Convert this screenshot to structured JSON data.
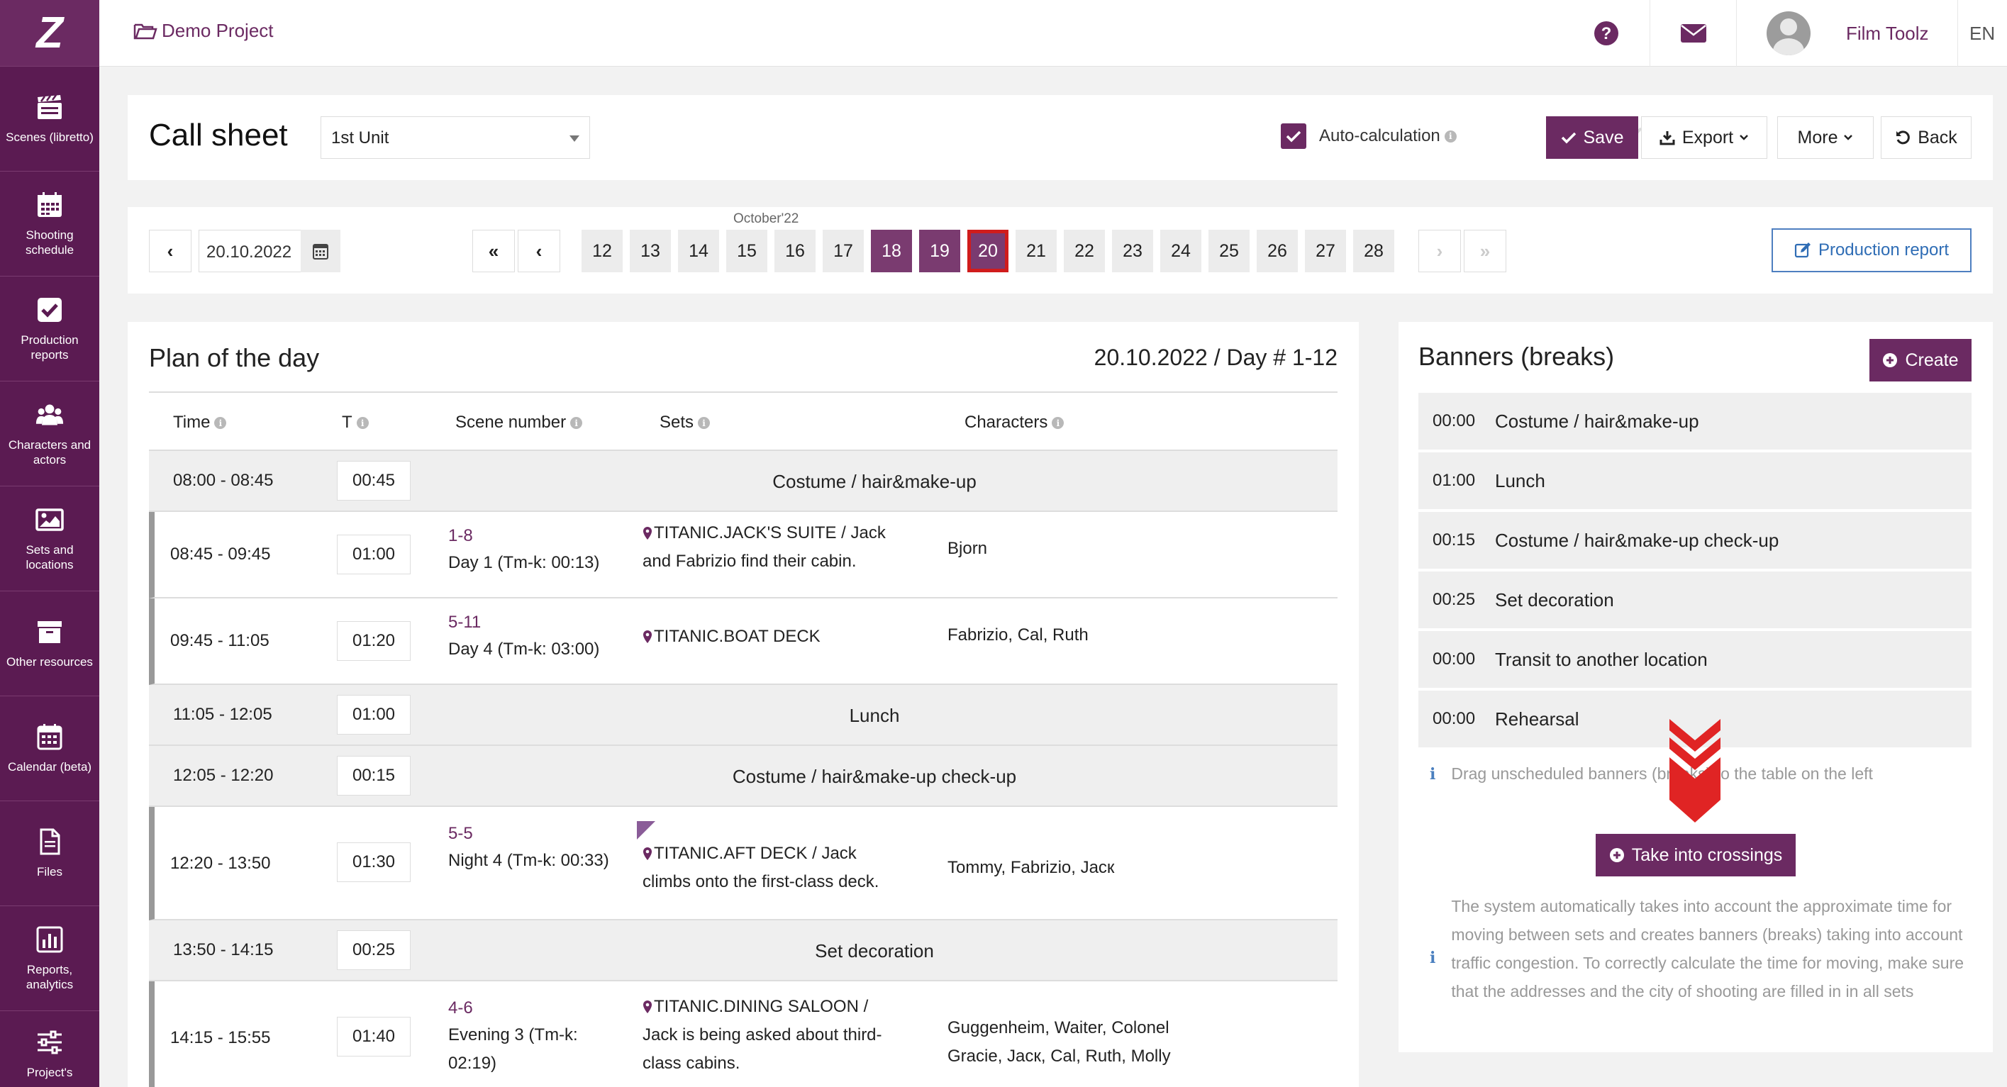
{
  "sidebar": {
    "logo": "Z",
    "items": [
      {
        "label": "Scenes (libretto)",
        "icon": "clapperboard-icon"
      },
      {
        "label": "Shooting schedule",
        "icon": "calendar-grid-icon"
      },
      {
        "label": "Production reports",
        "icon": "check-square-icon"
      },
      {
        "label": "Characters and actors",
        "icon": "users-icon"
      },
      {
        "label": "Sets and locations",
        "icon": "image-icon"
      },
      {
        "label": "Other resources",
        "icon": "archive-icon"
      },
      {
        "label": "Calendar (beta)",
        "icon": "calendar-icon"
      },
      {
        "label": "Files",
        "icon": "file-icon"
      },
      {
        "label": "Reports, analytics",
        "icon": "bar-chart-icon"
      },
      {
        "label": "Project's",
        "icon": "sliders-icon"
      }
    ]
  },
  "topbar": {
    "project": "Demo Project",
    "user_name": "Film Toolz",
    "lang": "EN"
  },
  "header": {
    "title": "Call sheet",
    "unit": "1st Unit",
    "autocalc_label": "Auto-calculation",
    "autocalc_checked": true,
    "save": "Save",
    "export": "Export",
    "more": "More",
    "back": "Back"
  },
  "datenav": {
    "date": "20.10.2022",
    "month": "October'22",
    "days": [
      "12",
      "13",
      "14",
      "15",
      "16",
      "17",
      "18",
      "19",
      "20",
      "21",
      "22",
      "23",
      "24",
      "25",
      "26",
      "27",
      "28"
    ],
    "selected_days": [
      "18",
      "19"
    ],
    "current_day": "20",
    "first": "«",
    "prev": "‹",
    "next": "›",
    "last": "»",
    "production_report": "Production report"
  },
  "plan": {
    "title": "Plan of the day",
    "date_label": "20.10.2022 / Day # 1-12",
    "columns": {
      "time": "Time",
      "t": "T",
      "scene": "Scene number",
      "sets": "Sets",
      "characters": "Characters"
    },
    "rows": [
      {
        "kind": "banner",
        "time": "08:00 - 08:45",
        "dur": "00:45",
        "name": "Costume / hair&make-up"
      },
      {
        "kind": "scene",
        "time": "08:45 - 09:45",
        "dur": "01:00",
        "num": "1-8",
        "day": "Day 1 (Tm-k: 00:13)",
        "set": "TITANIC.JACK'S SUITE / Jack and Fabrizio find their cabin.",
        "chars": "Bjorn"
      },
      {
        "kind": "scene",
        "time": "09:45 - 11:05",
        "dur": "01:20",
        "num": "5-11",
        "day": "Day 4 (Tm-k: 03:00)",
        "set": "TITANIC.BOAT DECK",
        "chars": "Fabrizio, Cal, Ruth"
      },
      {
        "kind": "banner",
        "time": "11:05 - 12:05",
        "dur": "01:00",
        "name": "Lunch"
      },
      {
        "kind": "banner",
        "time": "12:05 - 12:20",
        "dur": "00:15",
        "name": "Costume / hair&make-up check-up"
      },
      {
        "kind": "scene",
        "time": "12:20 - 13:50",
        "dur": "01:30",
        "num": "5-5",
        "day": "Night 4 (Tm-k: 00:33)",
        "set": "TITANIC.AFT DECK / Jack climbs onto the first-class deck.",
        "chars": "Tommy, Fabrizio, Jacк"
      },
      {
        "kind": "banner",
        "time": "13:50 - 14:15",
        "dur": "00:25",
        "name": "Set decoration"
      },
      {
        "kind": "scene",
        "time": "14:15 - 15:55",
        "dur": "01:40",
        "num": "4-6",
        "day": "Evening 3 (Tm-k: 02:19)",
        "set": "TITANIC.DINING SALOON / Jack is being asked about third-class cabins.",
        "chars": "Guggenheim, Waiter, Colonel Gracie, Jacк, Cal, Ruth, Molly"
      }
    ]
  },
  "banners": {
    "title": "Banners (breaks)",
    "create": "Create",
    "items": [
      {
        "time": "00:00",
        "label": "Costume / hair&make-up"
      },
      {
        "time": "01:00",
        "label": "Lunch"
      },
      {
        "time": "00:15",
        "label": "Costume / hair&make-up check-up"
      },
      {
        "time": "00:25",
        "label": "Set decoration"
      },
      {
        "time": "00:00",
        "label": "Transit to another location"
      },
      {
        "time": "00:00",
        "label": "Rehearsal"
      }
    ],
    "hint": "Drag unscheduled banners (breaks) to the table on the left",
    "take_crossings": "Take into crossings",
    "info": "The system automatically takes into account the approximate time for moving between sets and creates banners (breaks) taking into account traffic congestion. To correctly calculate the time for moving, make sure that the addresses and the city of shooting are filled in in all sets"
  },
  "colors": {
    "brand": "#6b2a62",
    "sidebar": "#5b1b52",
    "highlight": "#d01c1c",
    "link_blue": "#2f6db5"
  }
}
